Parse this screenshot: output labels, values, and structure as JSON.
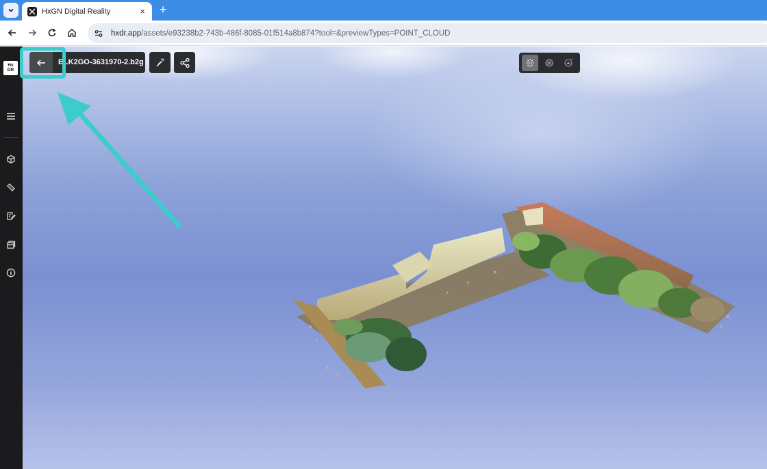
{
  "browser": {
    "tab_title": "HxGN Digital Reality",
    "tab_close": "×",
    "new_tab": "+",
    "url_host": "hxdr.app",
    "url_path": "/assets/e93238b2-743b-486f-8085-01f514a8b874?tool=&previewTypes=POINT_CLOUD"
  },
  "app": {
    "logo_line1": "Hx",
    "logo_line2": "DR",
    "asset_name": "BLK2GO-3631970-2.b2g",
    "sidebar_icons": [
      "menu-icon",
      "cube-icon",
      "ruler-icon",
      "annotate-icon",
      "layers-icon",
      "info-icon"
    ],
    "view_modes": [
      "point-cloud-icon",
      "mesh-icon",
      "panorama-icon"
    ],
    "active_view_mode": 0
  },
  "colors": {
    "tabbar": "#3d8ce6",
    "sidebar": "#1b1b1d",
    "pill": "#2b2c30",
    "highlight": "#3dcccc"
  }
}
